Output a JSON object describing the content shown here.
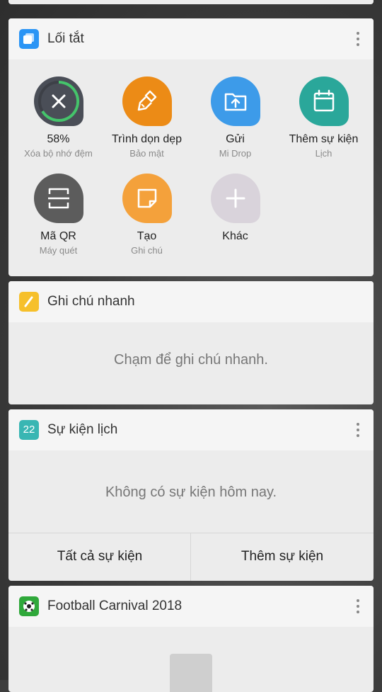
{
  "shortcuts": {
    "title": "Lối tắt",
    "items": [
      {
        "label": "58%",
        "sub": "Xóa bộ nhớ đệm",
        "icon": "close-icon",
        "color": "#4a4e57"
      },
      {
        "label": "Trình dọn dẹp",
        "sub": "Bảo mật",
        "icon": "broom-icon",
        "color": "#ec8b16"
      },
      {
        "label": "Gửi",
        "sub": "Mi Drop",
        "icon": "upload-folder-icon",
        "color": "#3d9be9"
      },
      {
        "label": "Thêm sự kiện",
        "sub": "Lịch",
        "icon": "calendar-icon",
        "color": "#2aa79a"
      },
      {
        "label": "Mã QR",
        "sub": "Máy quét",
        "icon": "qr-scan-icon",
        "color": "#5c5c5c"
      },
      {
        "label": "Tạo",
        "sub": "Ghi chú",
        "icon": "note-icon",
        "color": "#f4a13b"
      },
      {
        "label": "Khác",
        "sub": "",
        "icon": "plus-icon",
        "color": "#d9d3db"
      }
    ]
  },
  "notes": {
    "title": "Ghi chú nhanh",
    "message": "Chạm để ghi chú nhanh."
  },
  "calendar": {
    "title": "Sự kiện lịch",
    "day": "22",
    "message": "Không có sự kiện hôm nay.",
    "all_events": "Tất cả sự kiện",
    "add_event": "Thêm sự kiện"
  },
  "football": {
    "title": "Football Carnival 2018"
  },
  "colors": {
    "card_bg": "#ececec",
    "header_bg": "#f5f5f5",
    "shortcut_icon": "#2b95f5",
    "note_icon": "#f6c02b",
    "calendar_icon": "#39b6b3",
    "football_icon": "#2fa83a"
  }
}
